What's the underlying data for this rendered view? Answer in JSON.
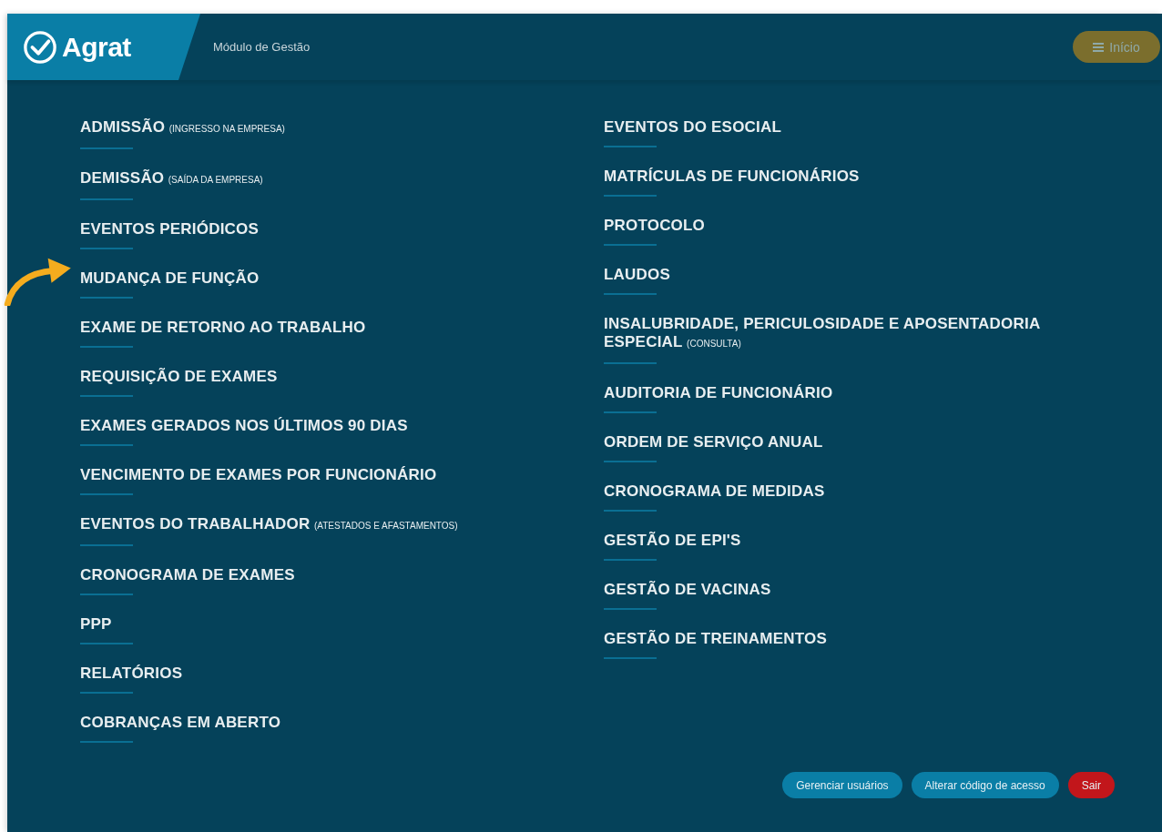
{
  "header": {
    "logo": "Agrat",
    "module_title": "Módulo de Gestão",
    "home_button": {
      "label": "Início"
    }
  },
  "menu": {
    "left_column": [
      {
        "label": "ADMISSÃO",
        "note": "(INGRESSO NA EMPRESA)"
      },
      {
        "label": "DEMISSÃO",
        "note": "(SAÍDA DA EMPRESA)"
      },
      {
        "label": "EVENTOS PERIÓDICOS"
      },
      {
        "label": "MUDANÇA DE FUNÇÃO",
        "highlighted": true
      },
      {
        "label": "EXAME DE RETORNO AO TRABALHO"
      },
      {
        "label": "REQUISIÇÃO DE EXAMES"
      },
      {
        "label": "EXAMES GERADOS NOS ÚLTIMOS 90 DIAS"
      },
      {
        "label": "VENCIMENTO DE EXAMES POR FUNCIONÁRIO"
      },
      {
        "label": "EVENTOS DO TRABALHADOR",
        "note": "(ATESTADOS E AFASTAMENTOS)"
      },
      {
        "label": "CRONOGRAMA DE EXAMES"
      },
      {
        "label": "PPP"
      },
      {
        "label": "RELATÓRIOS"
      },
      {
        "label": "COBRANÇAS EM ABERTO"
      }
    ],
    "right_column": [
      {
        "label": "EVENTOS DO ESOCIAL"
      },
      {
        "label": "MATRÍCULAS DE FUNCIONÁRIOS"
      },
      {
        "label": "PROTOCOLO"
      },
      {
        "label": "LAUDOS"
      },
      {
        "label": "INSALUBRIDADE, PERICULOSIDADE E APOSENTADORIA ESPECIAL",
        "note": "(CONSULTA)"
      },
      {
        "label": "AUDITORIA DE FUNCIONÁRIO"
      },
      {
        "label": "ORDEM DE SERVIÇO ANUAL"
      },
      {
        "label": "CRONOGRAMA DE MEDIDAS"
      },
      {
        "label": "GESTÃO DE EPI'S"
      },
      {
        "label": "GESTÃO DE VACINAS"
      },
      {
        "label": "GESTÃO DE TREINAMENTOS"
      }
    ]
  },
  "footer_buttons": [
    {
      "label": "Gerenciar usuários",
      "kind": "primary"
    },
    {
      "label": "Alterar código de acesso",
      "kind": "primary"
    },
    {
      "label": "Sair",
      "kind": "danger"
    }
  ]
}
